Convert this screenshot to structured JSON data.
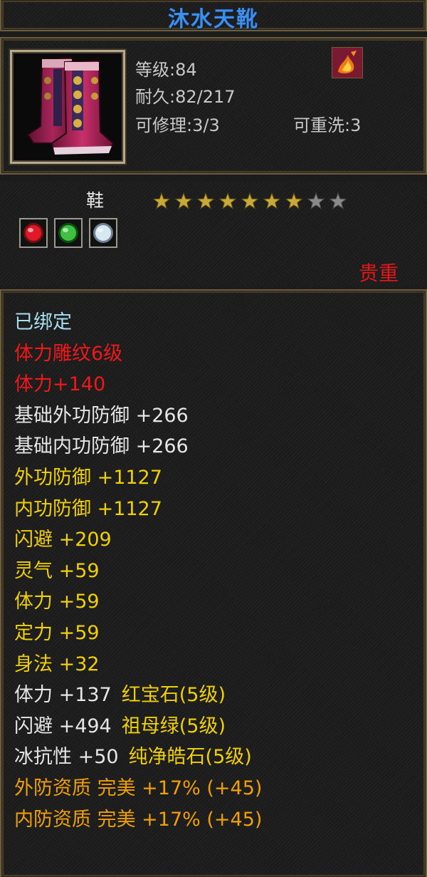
{
  "item": {
    "name": "沐水天靴",
    "type": "鞋",
    "quality": "贵重",
    "stats": {
      "level": "等级:84",
      "durability": "耐久:82/217",
      "repair": "可修理:3/3",
      "rewash": "可重洗:3"
    },
    "stars": {
      "filled": 7,
      "total": 9
    },
    "gems": [
      {
        "icon": "ruby-gem-icon"
      },
      {
        "icon": "emerald-gem-icon"
      },
      {
        "icon": "diamond-gem-icon"
      }
    ]
  },
  "attributes": [
    {
      "text": "已绑定",
      "color": "#a8e0f0"
    },
    {
      "text": "体力雕纹6级",
      "color": "#f01818"
    },
    {
      "text": "体力+140",
      "color": "#f01818"
    },
    {
      "text": "基础外功防御 +266",
      "color": "#e6e6e6"
    },
    {
      "text": "基础内功防御 +266",
      "color": "#e6e6e6"
    },
    {
      "text": "外功防御 +1127",
      "color": "#f0d000"
    },
    {
      "text": "内功防御 +1127",
      "color": "#f0d000"
    },
    {
      "text": "闪避 +209",
      "color": "#f0d000"
    },
    {
      "text": "灵气 +59",
      "color": "#f0d000"
    },
    {
      "text": "体力 +59",
      "color": "#f0d000"
    },
    {
      "text": "定力 +59",
      "color": "#f0d000"
    },
    {
      "text": "身法 +32",
      "color": "#f0d000"
    },
    {
      "gem": true,
      "stat": "体力 +137",
      "gemname": "红宝石(5级)"
    },
    {
      "gem": true,
      "stat": "闪避 +494",
      "gemname": "祖母绿(5级)"
    },
    {
      "gem": true,
      "stat": "冰抗性 +50",
      "gemname": "纯净皓石(5级)"
    },
    {
      "text": "外防资质 完美 +17% (+45)",
      "color": "#f0a000"
    },
    {
      "text": "内防资质 完美 +17% (+45)",
      "color": "#f0a000"
    }
  ]
}
